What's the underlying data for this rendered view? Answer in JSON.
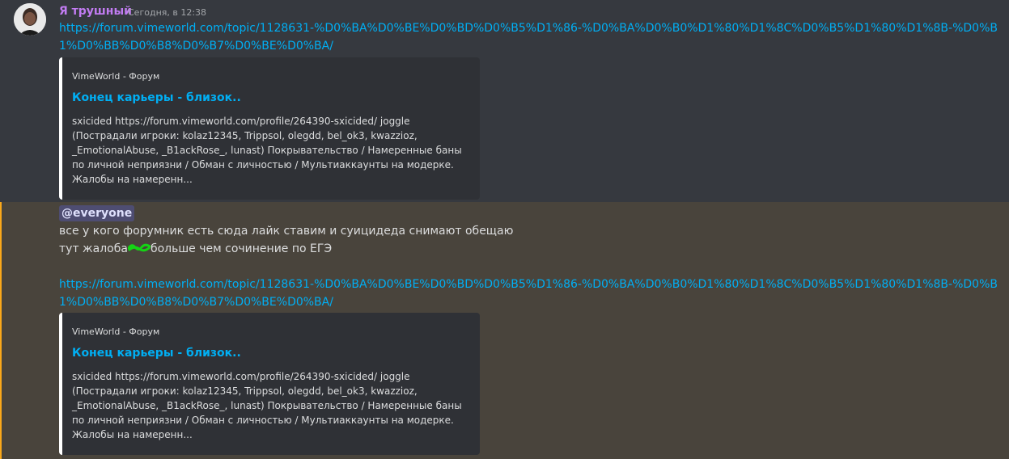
{
  "message1": {
    "author": "Я трушный",
    "timestamp": "Сегодня, в 12:38",
    "link": "https://forum.vimeworld.com/topic/1128631-%D0%BA%D0%BE%D0%BD%D0%B5%D1%86-%D0%BA%D0%B0%D1%80%D1%8C%D0%B5%D1%80%D1%8B-%D0%B1%D0%BB%D0%B8%D0%B7%D0%BE%D0%BA/",
    "embed": {
      "provider": "VimeWorld - Форум",
      "title": "Конец карьеры - близок..",
      "description": "sxicided https://forum.vimeworld.com/profile/264390-sxicided/ joggle (Пострадали игроки: kolaz12345, Trippsol, olegdd, bel_ok3, kwazzioz, _EmotionalAbuse, _B1ackRose_, lunast) Покрывательство / Намеренные баны по личной неприязни / Обман с личностью / Мультиаккаунты на модерке. Жалобы на намеренн..."
    }
  },
  "message2": {
    "mention": "@everyone",
    "line1": "все у кого форумник есть сюда лайк ставим и суицидеда снимают обещаю",
    "line2_before": "тут жалоба",
    "line2_after": "больше чем сочинение по ЕГЭ",
    "link": "https://forum.vimeworld.com/topic/1128631-%D0%BA%D0%BE%D0%BD%D0%B5%D1%86-%D0%BA%D0%B0%D1%80%D1%8C%D0%B5%D1%80%D1%8B-%D0%B1%D0%BB%D0%B8%D0%B7%D0%BE%D0%BA/",
    "embed": {
      "provider": "VimeWorld - Форум",
      "title": "Конец карьеры - близок..",
      "description": "sxicided https://forum.vimeworld.com/profile/264390-sxicided/ joggle (Пострадали игроки: kolaz12345, Trippsol, olegdd, bel_ok3, kwazzioz, _EmotionalAbuse, _B1ackRose_, lunast) Покрывательство / Намеренные баны по личной неприязни / Обман с личностью / Мультиаккаунты на модерке. Жалобы на намеренн..."
    }
  },
  "colors": {
    "author": "#c27cf2",
    "link": "#00aff4",
    "mention_highlight": "#faa81a",
    "scribble": "#14d414"
  }
}
